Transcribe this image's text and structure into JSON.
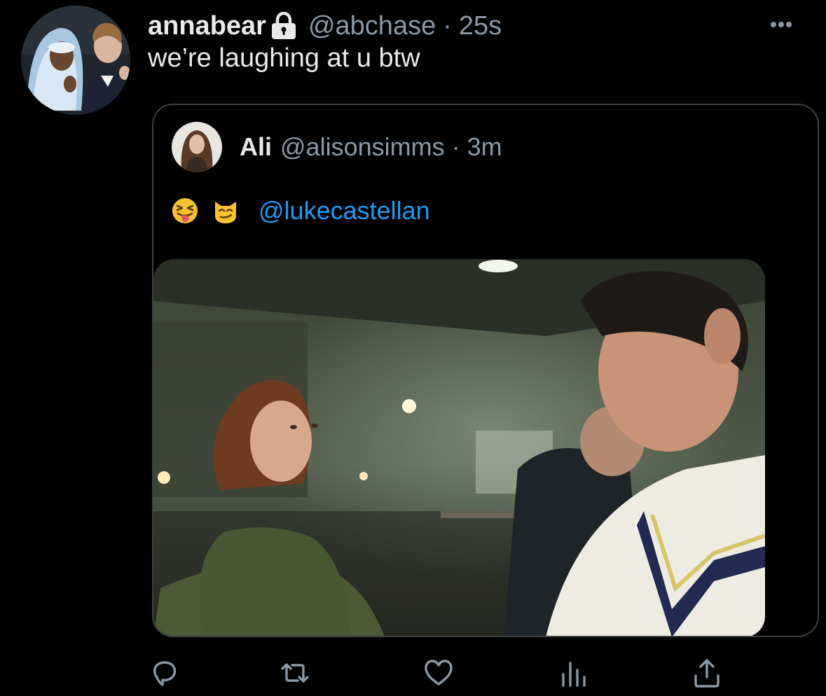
{
  "tweet": {
    "author": {
      "display_name": "annabear",
      "handle": "@abchase",
      "separator": "·",
      "time": "25s",
      "protected_icon": "lock-icon",
      "avatar_icon": "profile-photo"
    },
    "text": "we’re laughing at u btw",
    "more_icon": "ellipsis-icon"
  },
  "quoted_tweet": {
    "author": {
      "display_name": "Ali",
      "handle": "@alisonsimms",
      "separator": "·",
      "time": "3m",
      "avatar_icon": "profile-photo"
    },
    "emojis": [
      "😝",
      "😼"
    ],
    "mention": "@lukecastellan",
    "media_icon": "photo"
  },
  "actions": [
    {
      "name": "reply",
      "icon": "reply-icon"
    },
    {
      "name": "retweet",
      "icon": "retweet-icon"
    },
    {
      "name": "like",
      "icon": "heart-icon"
    },
    {
      "name": "analytics",
      "icon": "analytics-icon"
    },
    {
      "name": "share",
      "icon": "share-icon"
    }
  ],
  "colors": {
    "background": "#000000",
    "text_primary": "#e7e9ea",
    "text_secondary": "#8b98a5",
    "link": "#1d9bf0",
    "border": "#3e4144"
  }
}
